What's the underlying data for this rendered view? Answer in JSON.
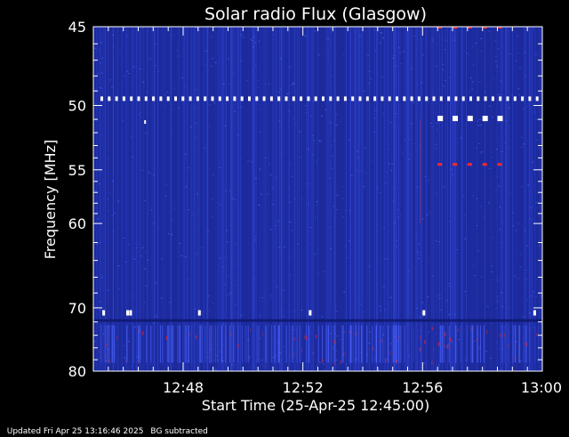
{
  "chart_data": {
    "type": "heatmap",
    "title": "Solar radio Flux (Glasgow)",
    "xlabel": "Start Time (25-Apr-25 12:45:00)",
    "ylabel": "Frequency [MHz]",
    "x_ticks": [
      "12:48",
      "12:52",
      "12:56",
      "13:00"
    ],
    "x_tick_minutes": [
      3,
      7,
      11,
      15
    ],
    "xlim_minutes": [
      0,
      15
    ],
    "y_ticks": [
      45,
      50,
      55,
      60,
      70,
      80
    ],
    "ylim": [
      45,
      80
    ],
    "y_scale": "reciprocal",
    "colors": {
      "background": "#1c2a9c",
      "noise": "#3347d8",
      "hot": "#ff2a2a",
      "spike": "#ffffff",
      "frame": "#ffffff"
    },
    "interference_lines_mhz": [
      49.5,
      70.7
    ],
    "rfi_spots_mhz": [
      45.0,
      51.0,
      54.5
    ]
  },
  "footer": {
    "updated": "Updated Fri Apr 25 13:16:46 2025",
    "note": "BG subtracted"
  }
}
